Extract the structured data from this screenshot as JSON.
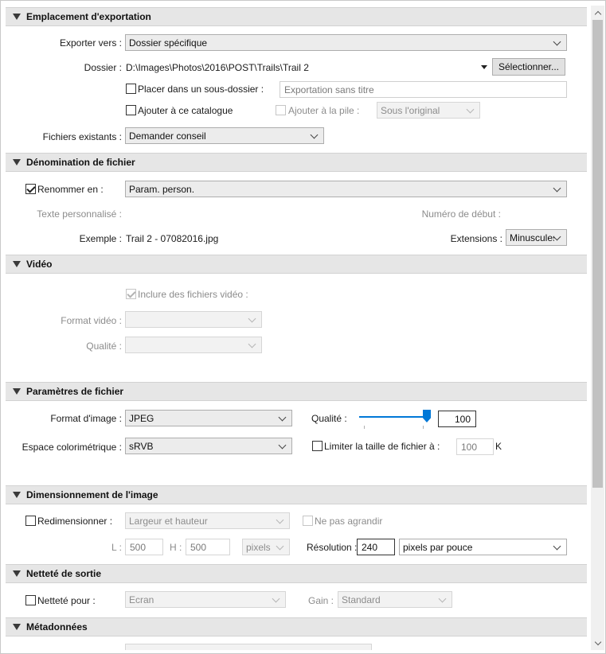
{
  "location": {
    "title": "Emplacement d'exportation",
    "export_to_label": "Exporter vers :",
    "export_to_value": "Dossier spécifique",
    "folder_label": "Dossier :",
    "folder_path": "D:\\Images\\Photos\\2016\\POST\\Trails\\Trail 2",
    "select_button": "Sélectionner...",
    "subfolder_label": "Placer dans un sous-dossier :",
    "subfolder_placeholder": "Exportation sans titre",
    "add_catalog_label": "Ajouter à ce catalogue",
    "add_stack_label": "Ajouter à la pile :",
    "stack_value": "Sous l'original",
    "existing_label": "Fichiers existants :",
    "existing_value": "Demander conseil"
  },
  "naming": {
    "title": "Dénomination de fichier",
    "rename_label": "Renommer en :",
    "rename_value": "Param. person.",
    "custom_text_label": "Texte personnalisé :",
    "start_number_label": "Numéro de début :",
    "example_label": "Exemple :",
    "example_value": "Trail 2 - 07082016.jpg",
    "extensions_label": "Extensions :",
    "extensions_value": "Minuscules"
  },
  "video": {
    "title": "Vidéo",
    "include_label": "Inclure des fichiers vidéo :",
    "format_label": "Format vidéo :",
    "quality_label": "Qualité :"
  },
  "file_settings": {
    "title": "Paramètres de fichier",
    "format_label": "Format d'image :",
    "format_value": "JPEG",
    "quality_label": "Qualité :",
    "quality_value": "100",
    "quality_fraction": 1.0,
    "colorspace_label": "Espace colorimétrique :",
    "colorspace_value": "sRVB",
    "limit_label": "Limiter la taille de fichier à :",
    "limit_value": "100",
    "limit_unit": "K"
  },
  "sizing": {
    "title": "Dimensionnement de l'image",
    "resize_label": "Redimensionner :",
    "resize_value": "Largeur et hauteur",
    "no_enlarge_label": "Ne pas agrandir",
    "w_label": "L :",
    "w_value": "500",
    "h_label": "H :",
    "h_value": "500",
    "unit_value": "pixels",
    "resolution_label": "Résolution :",
    "resolution_value": "240",
    "resolution_unit": "pixels par pouce"
  },
  "sharpening": {
    "title": "Netteté de sortie",
    "sharpen_label": "Netteté pour :",
    "sharpen_value": "Ecran",
    "gain_label": "Gain :",
    "gain_value": "Standard"
  },
  "metadata": {
    "title": "Métadonnées"
  },
  "colors": {
    "accent": "#0078d7",
    "header_bg": "#e6e6e6"
  }
}
